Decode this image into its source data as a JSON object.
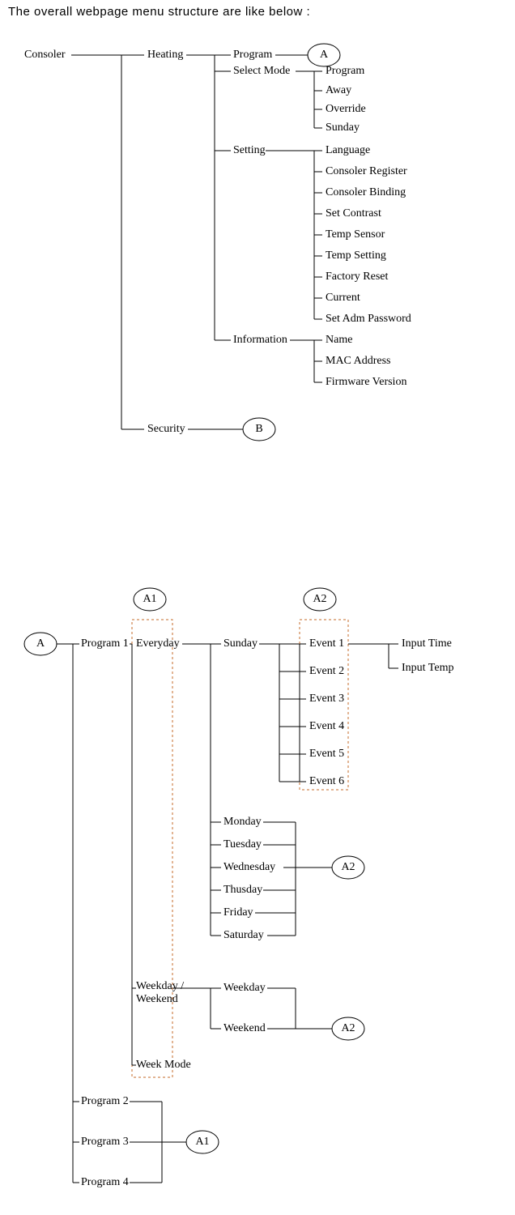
{
  "title": "The overall webpage menu structure are like below :",
  "refs": {
    "A": "A",
    "B": "B",
    "A1": "A1",
    "A2": "A2"
  },
  "top": {
    "root": "Consoler",
    "heating": "Heating",
    "security": "Security",
    "program": "Program",
    "select_mode": "Select Mode",
    "setting": "Setting",
    "information": "Information",
    "select_mode_items": {
      "program": "Program",
      "away": "Away",
      "override": "Override",
      "sunday": "Sunday"
    },
    "setting_items": {
      "language": "Language",
      "consoler_register": "Consoler Register",
      "consoler_binding": "Consoler Binding",
      "set_contrast": "Set Contrast",
      "temp_sensor": "Temp Sensor",
      "temp_setting": "Temp Setting",
      "factory_reset": "Factory Reset",
      "current": "Current",
      "set_adm_password": "Set Adm Password"
    },
    "information_items": {
      "name": "Name",
      "mac_address": "MAC Address",
      "firmware_version": "Firmware Version"
    }
  },
  "bottom": {
    "programs": {
      "p1": "Program 1",
      "p2": "Program 2",
      "p3": "Program 3",
      "p4": "Program 4"
    },
    "modes": {
      "everyday": "Everyday",
      "weekday_weekend": "Weekday /\nWeekend",
      "week_mode": "Week Mode"
    },
    "days": {
      "sunday": "Sunday",
      "monday": "Monday",
      "tuesday": "Tuesday",
      "wednesday": "Wednesday",
      "thusday": "Thusday",
      "friday": "Friday",
      "saturday": "Saturday"
    },
    "ww": {
      "weekday": "Weekday",
      "weekend": "Weekend"
    },
    "events": {
      "e1": "Event 1",
      "e2": "Event 2",
      "e3": "Event 3",
      "e4": "Event 4",
      "e5": "Event 5",
      "e6": "Event 6"
    },
    "inputs": {
      "time": "Input  Time",
      "temp": "Input Temp"
    }
  }
}
